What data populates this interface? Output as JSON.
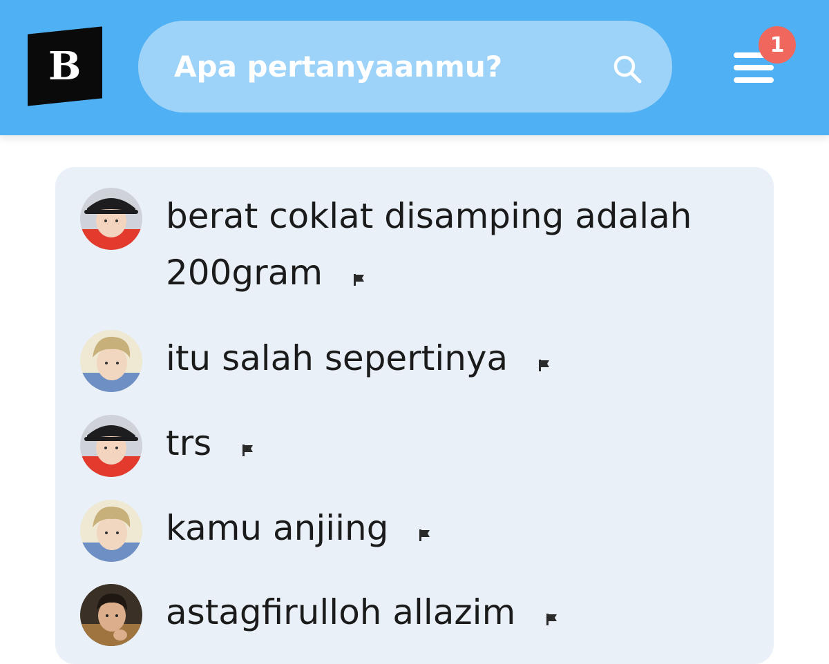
{
  "header": {
    "logo_letter": "B",
    "search_placeholder": "Apa pertanyaanmu?",
    "notification_count": "1",
    "colors": {
      "bar": "#4fb0f3",
      "search_bg": "#9dd3f9",
      "badge": "#f0685d"
    },
    "icons": [
      "search-icon",
      "menu-icon"
    ]
  },
  "comments": [
    {
      "avatar": "user-a",
      "text": "berat coklat disamping adalah 200gram",
      "flag_icon": "flag-icon"
    },
    {
      "avatar": "user-b",
      "text": "itu salah sepertinya",
      "flag_icon": "flag-icon"
    },
    {
      "avatar": "user-a",
      "text": "trs",
      "flag_icon": "flag-icon"
    },
    {
      "avatar": "user-b",
      "text": "kamu anjiing",
      "flag_icon": "flag-icon"
    },
    {
      "avatar": "user-c",
      "text": "astagfirulloh allazim",
      "flag_icon": "flag-icon"
    }
  ]
}
